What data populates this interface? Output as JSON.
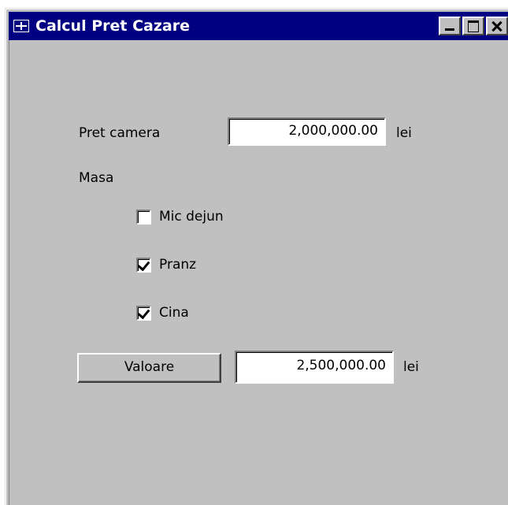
{
  "window": {
    "title": "Calcul Pret Cazare"
  },
  "form": {
    "room_price_label": "Pret camera",
    "room_price_value": "2,000,000.00",
    "room_price_unit": "lei",
    "meals_label": "Masa",
    "meals": [
      {
        "label": "Mic dejun",
        "checked": false
      },
      {
        "label": "Pranz",
        "checked": true
      },
      {
        "label": "Cina",
        "checked": true
      }
    ],
    "value_button_label": "Valoare",
    "total_value": "2,500,000.00",
    "total_unit": "lei"
  },
  "icons": {
    "app": "form-window-icon",
    "minimize": "minimize-icon",
    "maximize": "maximize-icon",
    "close": "close-icon"
  },
  "colors": {
    "titlebar": "#000080",
    "window_bg": "#c0c0c0"
  }
}
